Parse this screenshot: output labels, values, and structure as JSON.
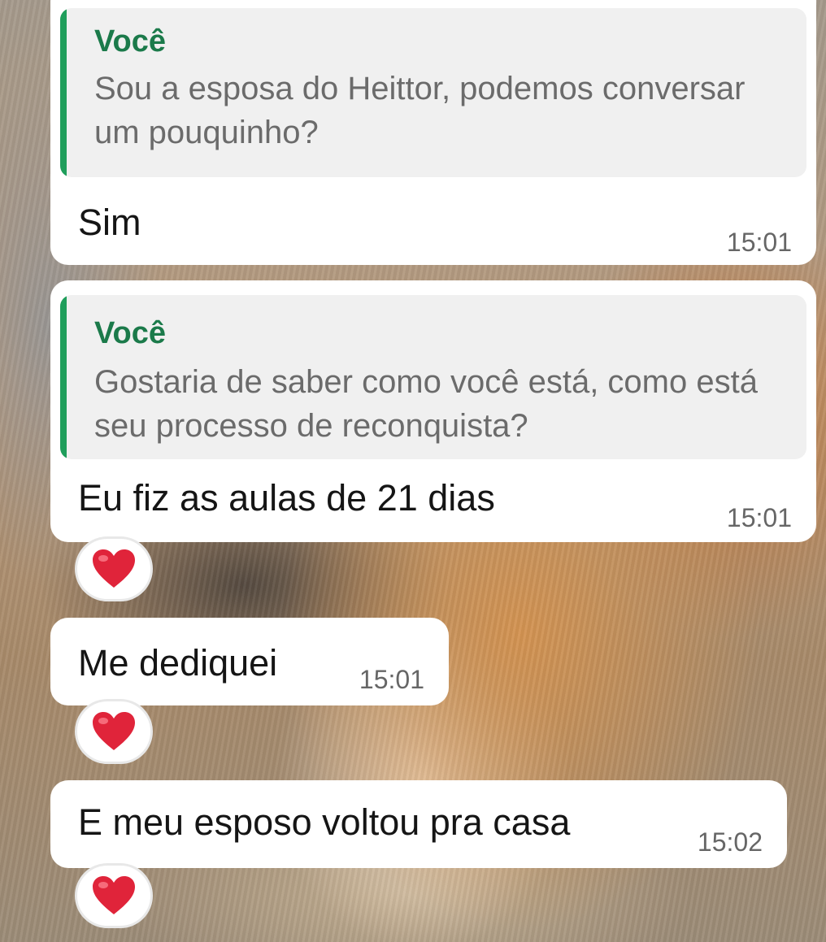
{
  "messages": [
    {
      "quote": {
        "author": "Você",
        "text": "Sou a esposa do Heittor, podemos conversar um pouquinho?"
      },
      "text": "Sim",
      "time": "15:01",
      "reaction": null
    },
    {
      "quote": {
        "author": "Você",
        "text": "Gostaria de saber como você está, como está seu processo de reconquista?"
      },
      "text": "Eu fiz as aulas de 21 dias",
      "time": "15:01",
      "reaction": "red-heart"
    },
    {
      "quote": null,
      "text": "Me dediquei",
      "time": "15:01",
      "reaction": "red-heart"
    },
    {
      "quote": null,
      "text": "E meu esposo voltou pra casa",
      "time": "15:02",
      "reaction": "red-heart"
    }
  ],
  "colors": {
    "quote_bar": "#1f9e5b",
    "quote_author": "#1b7a4a",
    "bubble": "#ffffff",
    "heart": "#e0243a"
  }
}
